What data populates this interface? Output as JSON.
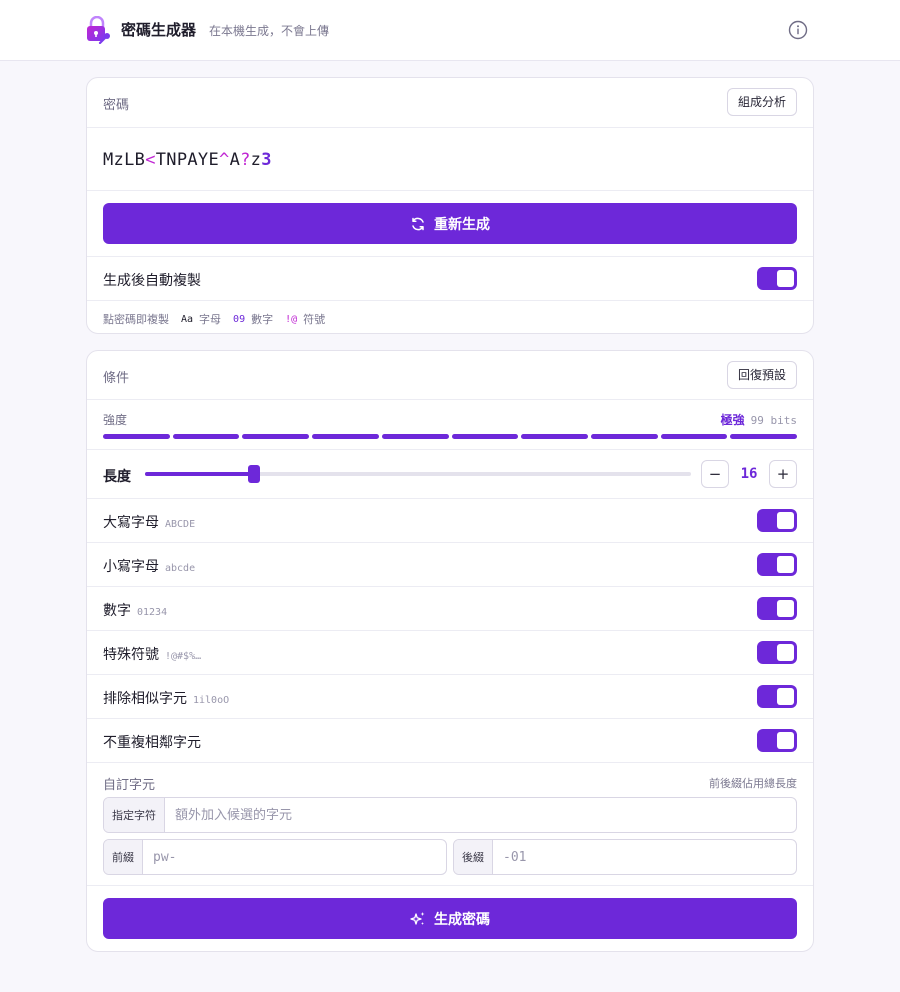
{
  "header": {
    "title": "密碼生成器",
    "subtitle": "在本機生成，不會上傳",
    "logo_icon": "padlock-key-icon",
    "info_icon": "info-icon"
  },
  "password_card": {
    "label": "密碼",
    "analyze_button": "組成分析",
    "password_value": "MzLB<TNPAYE^A?z3",
    "regenerate_button": "重新生成",
    "regenerate_icon": "refresh-icon",
    "auto_copy_label": "生成後自動複製",
    "auto_copy_on": true,
    "legend": {
      "hint": "點密碼即複製",
      "letters_code": "Aa",
      "letters_label": "字母",
      "digits_code": "09",
      "digits_label": "數字",
      "symbols_code": "!@",
      "symbols_label": "符號"
    }
  },
  "options_card": {
    "label": "條件",
    "reset_button": "回復預設",
    "strength": {
      "label": "強度",
      "level": "極強",
      "bits": "99 bits",
      "segments_total": 10,
      "segments_filled": 10
    },
    "length": {
      "label": "長度",
      "value": "16",
      "min": 4,
      "max": 64,
      "decrement": "−",
      "increment": "+"
    },
    "toggles": [
      {
        "key": "uppercase",
        "label": "大寫字母",
        "hint": "ABCDE",
        "on": true
      },
      {
        "key": "lowercase",
        "label": "小寫字母",
        "hint": "abcde",
        "on": true
      },
      {
        "key": "digits",
        "label": "數字",
        "hint": "01234",
        "on": true
      },
      {
        "key": "symbols",
        "label": "特殊符號",
        "hint": "!@#$%…",
        "on": true
      },
      {
        "key": "exclude-similar",
        "label": "排除相似字元",
        "hint": "1il0oO",
        "on": true
      },
      {
        "key": "no-repeat",
        "label": "不重複相鄰字元",
        "hint": "",
        "on": true
      }
    ],
    "custom": {
      "label": "自訂字元",
      "note": "前後綴佔用總長度",
      "chars_addon": "指定字符",
      "chars_placeholder": "額外加入候選的字元",
      "prefix_addon": "前綴",
      "prefix_placeholder": "pw-",
      "suffix_addon": "後綴",
      "suffix_placeholder": "-01"
    },
    "generate_button": "生成密碼",
    "generate_icon": "sparkles-icon"
  },
  "colors": {
    "accent": "#6d28d9",
    "symbol": "#c026d3",
    "background": "#f8f7fc"
  }
}
